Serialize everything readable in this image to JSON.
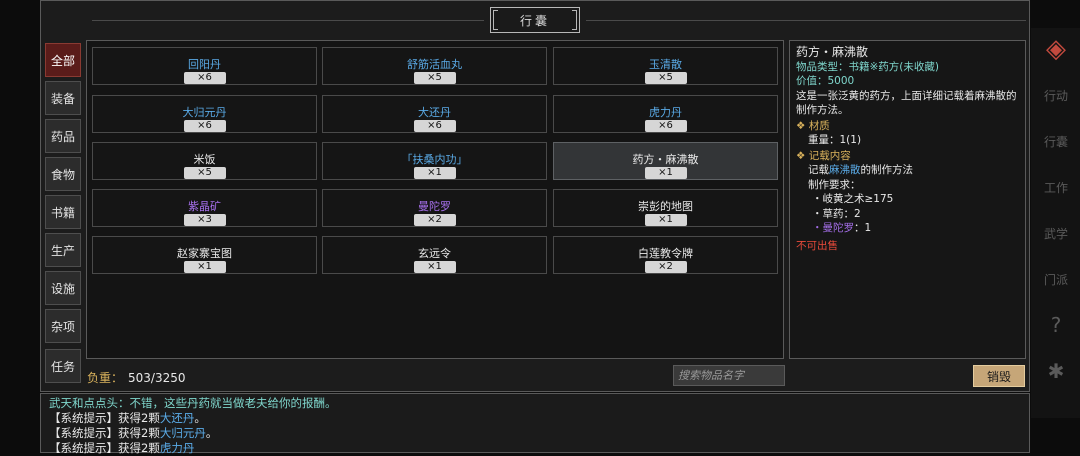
{
  "window": {
    "title": "行囊"
  },
  "tabs": [
    {
      "label": "全部",
      "active": true
    },
    {
      "label": "装备"
    },
    {
      "label": "药品"
    },
    {
      "label": "食物"
    },
    {
      "label": "书籍"
    },
    {
      "label": "生产"
    },
    {
      "label": "设施"
    },
    {
      "label": "杂项"
    },
    {
      "label": "任务"
    }
  ],
  "items": [
    {
      "name": "回阳丹",
      "count": "×6",
      "color": "#5aaae6"
    },
    {
      "name": "舒筋活血丸",
      "count": "×5",
      "color": "#5aaae6"
    },
    {
      "name": "玉清散",
      "count": "×5",
      "color": "#5aaae6"
    },
    {
      "name": "大归元丹",
      "count": "×6",
      "color": "#5aaae6"
    },
    {
      "name": "大还丹",
      "count": "×6",
      "color": "#5aaae6"
    },
    {
      "name": "虎力丹",
      "count": "×6",
      "color": "#5aaae6"
    },
    {
      "name": "米饭",
      "count": "×5",
      "color": "#e8e8e8"
    },
    {
      "name": "「扶桑内功」",
      "count": "×1",
      "color": "#5aaae6"
    },
    {
      "name": "药方・麻沸散",
      "count": "×1",
      "color": "#e8e8e8",
      "selected": true
    },
    {
      "name": "紫晶矿",
      "count": "×3",
      "color": "#a46ee8"
    },
    {
      "name": "曼陀罗",
      "count": "×2",
      "color": "#a46ee8"
    },
    {
      "name": "崇彭的地图",
      "count": "×1",
      "color": "#e8e8e8"
    },
    {
      "name": "赵家寨宝图",
      "count": "×1",
      "color": "#e8e8e8"
    },
    {
      "name": "玄远令",
      "count": "×1",
      "color": "#e8e8e8"
    },
    {
      "name": "白莲教令牌",
      "count": "×2",
      "color": "#e8e8e8"
    }
  ],
  "footer": {
    "weight_label": "负重：",
    "weight_value": "503/3250",
    "search_placeholder": "搜索物品名字",
    "sell_label": "销毁"
  },
  "detail": {
    "title": "药方・麻沸散",
    "type_label": "物品类型：",
    "type_value": "书籍※药方(未收藏)",
    "value_label": "价值：",
    "value_value": "5000",
    "desc": "这是一张泛黄的药方，上面详细记载着麻沸散的制作方法。",
    "material_header": "材质",
    "weight_line": "重量：1(1)",
    "content_header": "记载内容",
    "content_pre": "记载",
    "content_link": "麻沸散",
    "content_post": "的制作方法",
    "req_header": "制作要求：",
    "req1": "・岐黄之术≥175",
    "req2": "・草药：2",
    "req3_name": "・曼陀罗",
    "req3_val": "：1",
    "not_sellable": "不可出售",
    "colors": {
      "header": "#d9b25c",
      "link": "#5aaae6",
      "purple": "#a46ee8",
      "red": "#e84a3a",
      "teal": "#7fd6cc"
    }
  },
  "side_icons": [
    {
      "icon": "diamond-arrow-icon",
      "glyph": "◈"
    },
    {
      "icon": "xingdong-icon",
      "glyph": "行动"
    },
    {
      "icon": "xingnang-icon",
      "glyph": "行囊"
    },
    {
      "icon": "gongzuo-icon",
      "glyph": "工作"
    },
    {
      "icon": "wuxue-icon",
      "glyph": "武学"
    },
    {
      "icon": "menpai-icon",
      "glyph": "门派"
    },
    {
      "icon": "help-icon",
      "glyph": "?"
    },
    {
      "icon": "settings-icon",
      "glyph": "✱"
    }
  ],
  "chat": {
    "line1": "武天和点点头：不错，这些丹药就当做老夫给你的报酬。",
    "line2_pre": "【系统提示】获得2颗",
    "line2_item": "大还丹",
    "line2_post": "。",
    "line3_pre": "【系统提示】获得2颗",
    "line3_item": "大归元丹",
    "line3_post": "。",
    "line4_pre": "【系统提示】获得2颗",
    "line4_item": "虎力丹",
    "line4_post": ""
  }
}
